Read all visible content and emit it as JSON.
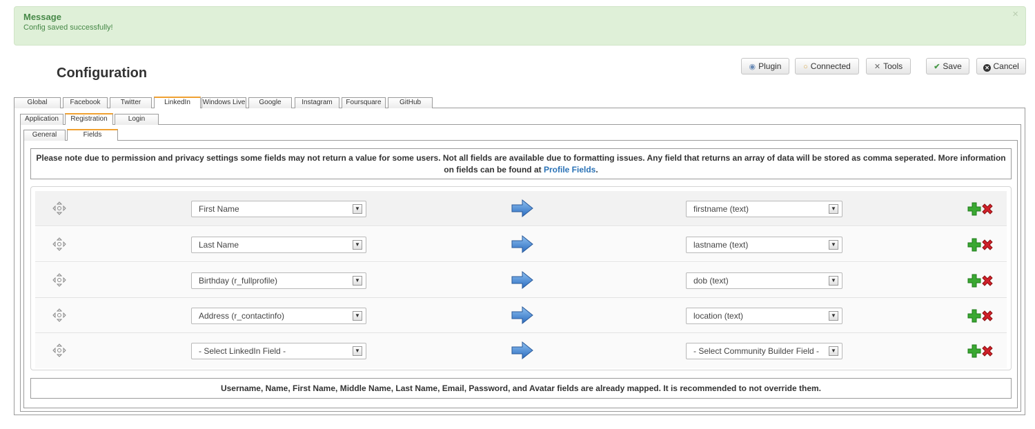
{
  "message": {
    "title": "Message",
    "text": "Config saved successfully!",
    "close": "×"
  },
  "page": {
    "title": "Configuration"
  },
  "toolbar": {
    "plugin": "Plugin",
    "connected": "Connected",
    "tools": "Tools",
    "save": "Save",
    "cancel": "Cancel"
  },
  "tabs": {
    "main": [
      "Global",
      "Facebook",
      "Twitter",
      "LinkedIn",
      "Windows Live",
      "Google",
      "Instagram",
      "Foursquare",
      "GitHub"
    ],
    "main_active": "LinkedIn",
    "sub": [
      "Application",
      "Registration",
      "Login"
    ],
    "sub_active": "Registration",
    "sub2": [
      "General",
      "Fields"
    ],
    "sub2_active": "Fields"
  },
  "note": {
    "text": "Please note due to permission and privacy settings some fields may not return a value for some users. Not all fields are available due to formatting issues. Any field that returns an array of data will be stored as comma seperated. More information on fields can be found at",
    "link": "Profile Fields",
    "end": "."
  },
  "rows": [
    {
      "source": "First Name",
      "target": "firstname (text)"
    },
    {
      "source": "Last Name",
      "target": "lastname (text)"
    },
    {
      "source": "Birthday (r_fullprofile)",
      "target": "dob (text)"
    },
    {
      "source": "Address (r_contactinfo)",
      "target": "location (text)"
    },
    {
      "source": "- Select LinkedIn Field -",
      "target": "- Select Community Builder Field -"
    }
  ],
  "footer_note": "Username, Name, First Name, Middle Name, Last Name, Email, Password, and Avatar fields are already mapped. It is recommended to not override them.",
  "colors": {
    "message_bg": "#dff0d8",
    "message_text": "#468847",
    "active_tab": "#f0a030",
    "link": "#2a72b6",
    "add_green": "#3aa832",
    "delete_red": "#d0202a",
    "arrow_blue": "#3d7fc9"
  },
  "icons": {
    "move": "move-icon",
    "arrow": "arrow-right-icon",
    "add": "plus-icon",
    "delete": "x-icon"
  }
}
